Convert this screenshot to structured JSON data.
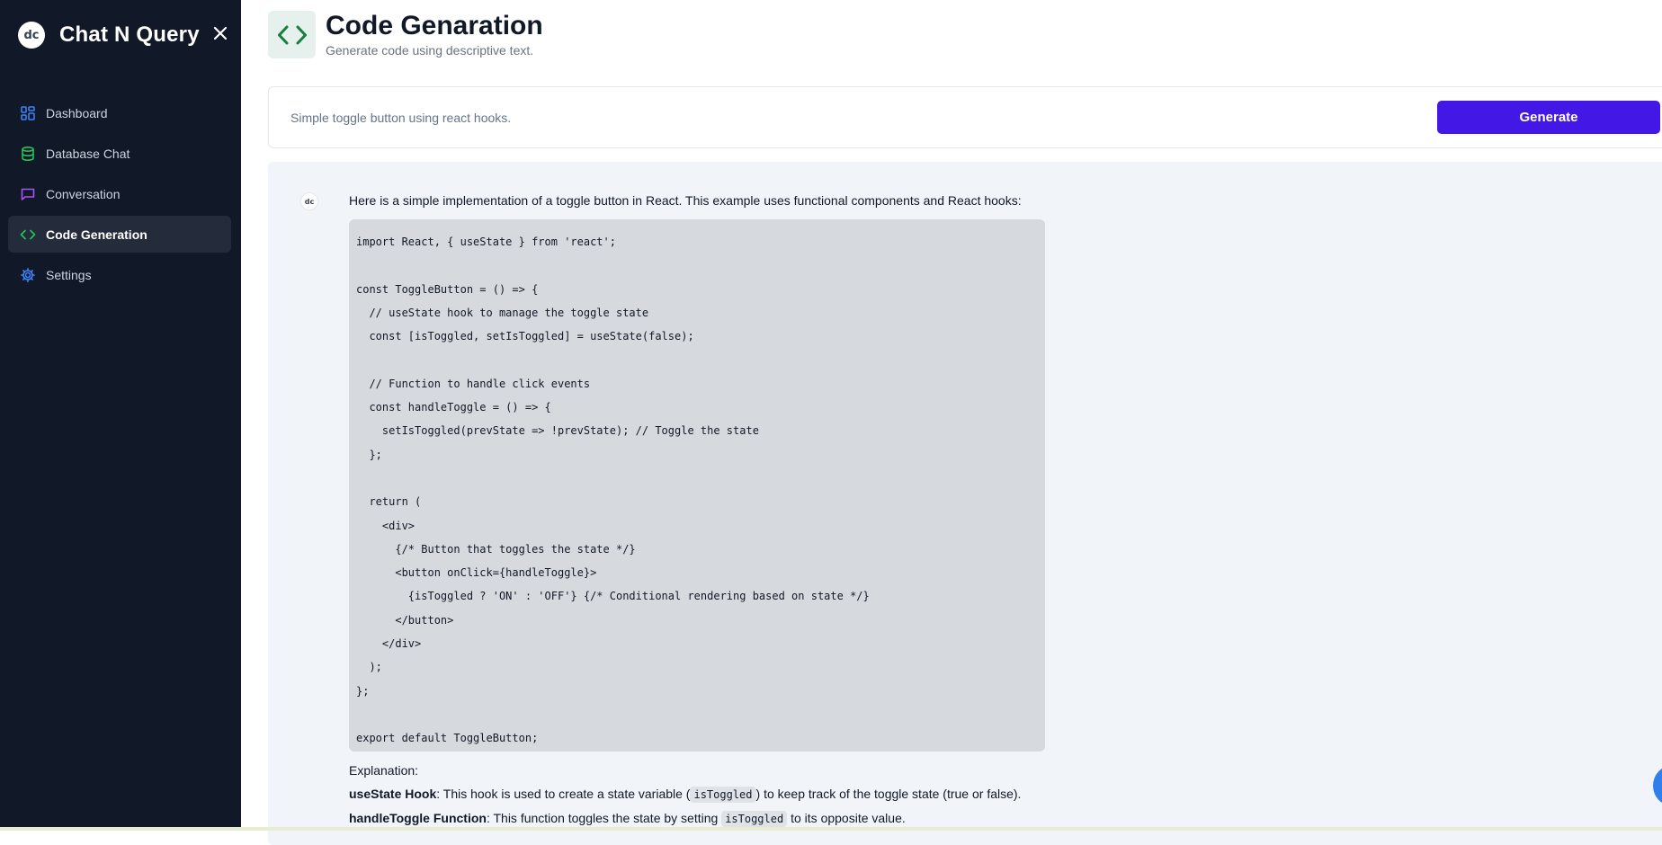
{
  "sidebar": {
    "logo_text": "dc",
    "app_title": "Chat N Query",
    "close_icon": "close-icon",
    "items": [
      {
        "label": "Dashboard",
        "icon": "dashboard-icon",
        "color": "#3b82f6",
        "active": false
      },
      {
        "label": "Database Chat",
        "icon": "database-icon",
        "color": "#22c55e",
        "active": false
      },
      {
        "label": "Conversation",
        "icon": "message-square-icon",
        "color": "#a855f7",
        "active": false
      },
      {
        "label": "Code Generation",
        "icon": "code-icon",
        "color": "#22c55e",
        "active": true
      },
      {
        "label": "Settings",
        "icon": "gear-icon",
        "color": "#3b82f6",
        "active": false
      }
    ]
  },
  "header": {
    "icon": "code-icon",
    "title": "Code Genaration",
    "subtitle": "Generate code using descriptive text."
  },
  "prompt": {
    "value": "Simple toggle button using react hooks.",
    "generate_label": "Generate",
    "accent": "#4318e6"
  },
  "response": {
    "avatar_text": "dc",
    "intro": "Here is a simple implementation of a toggle button in React. This example uses functional components and React hooks:",
    "code_lines": [
      "import React, { useState } from 'react';",
      "",
      "const ToggleButton = () => {",
      "  // useState hook to manage the toggle state",
      "  const [isToggled, setIsToggled] = useState(false);",
      "",
      "  // Function to handle click events",
      "  const handleToggle = () => {",
      "    setIsToggled(prevState => !prevState); // Toggle the state",
      "  };",
      "",
      "  return (",
      "    <div>",
      "      {/* Button that toggles the state */}",
      "      <button onClick={handleToggle}>",
      "        {isToggled ? 'ON' : 'OFF'} {/* Conditional rendering based on state */}",
      "      </button>",
      "    </div>",
      "  );",
      "};",
      "",
      "export default ToggleButton;"
    ],
    "explanation_label": "Explanation:",
    "explanations": [
      {
        "term": "useState Hook",
        "before": ": This hook is used to create a state variable (",
        "code": "isToggled",
        "after": ") to keep track of the toggle state (true or false)."
      },
      {
        "term": "handleToggle Function",
        "before": ": This function toggles the state by setting ",
        "code": "isToggled",
        "after": " to its opposite value."
      }
    ]
  }
}
